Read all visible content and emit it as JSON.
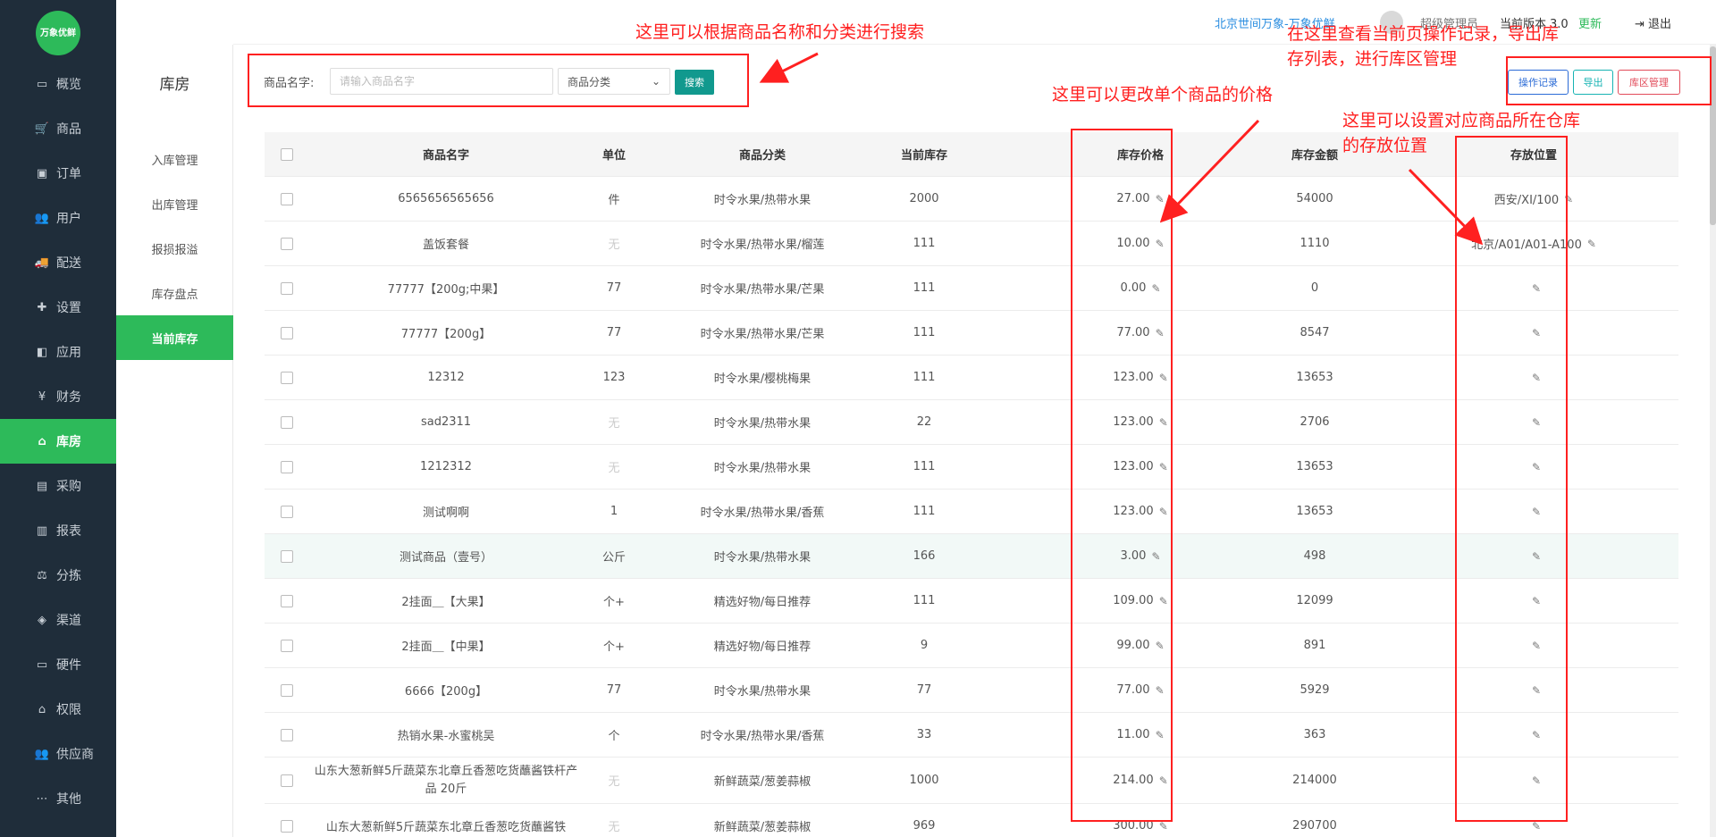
{
  "header": {
    "company_link": "北京世间万象-万象优鲜",
    "user_role": "超级管理员",
    "version_label": "当前版本",
    "version_number": "3.0",
    "update_label": "更新",
    "logout_label": "退出"
  },
  "brand": {
    "logo_text": "万象优鲜"
  },
  "sidebar": {
    "items": [
      {
        "label": "概览",
        "icon": "monitor-icon"
      },
      {
        "label": "商品",
        "icon": "cart-icon"
      },
      {
        "label": "订单",
        "icon": "order-icon"
      },
      {
        "label": "用户",
        "icon": "users-icon"
      },
      {
        "label": "配送",
        "icon": "truck-icon"
      },
      {
        "label": "设置",
        "icon": "puzzle-icon"
      },
      {
        "label": "应用",
        "icon": "app-icon"
      },
      {
        "label": "财务",
        "icon": "yen-icon"
      },
      {
        "label": "库房",
        "icon": "home-icon"
      },
      {
        "label": "采购",
        "icon": "bus-icon"
      },
      {
        "label": "报表",
        "icon": "chart-icon"
      },
      {
        "label": "分拣",
        "icon": "scale-icon"
      },
      {
        "label": "渠道",
        "icon": "box-icon"
      },
      {
        "label": "硬件",
        "icon": "desktop-icon"
      },
      {
        "label": "权限",
        "icon": "bank-icon"
      },
      {
        "label": "供应商",
        "icon": "supplier-icon"
      },
      {
        "label": "其他",
        "icon": "more-icon"
      }
    ]
  },
  "submenu": {
    "title": "库房",
    "items": [
      "入库管理",
      "出库管理",
      "报损报溢",
      "库存盘点",
      "当前库存"
    ]
  },
  "search": {
    "label": "商品名字:",
    "placeholder": "请输入商品名字",
    "category_select": "商品分类",
    "search_button": "搜索"
  },
  "actions": {
    "log_button": "操作记录",
    "export_button": "导出",
    "zone_button": "库区管理"
  },
  "table": {
    "columns": [
      "商品名字",
      "单位",
      "商品分类",
      "当前库存",
      "库存价格",
      "库存金额",
      "存放位置"
    ],
    "rows": [
      {
        "name": "6565656565656",
        "unit": "件",
        "category": "时令水果/热带水果",
        "stock": "2000",
        "price": "27.00",
        "amount": "54000",
        "location": "西安/XI/100"
      },
      {
        "name": "盖饭套餐",
        "unit": "无",
        "category": "时令水果/热带水果/榴莲",
        "stock": "111",
        "price": "10.00",
        "amount": "1110",
        "location": "北京/A01/A01-A100"
      },
      {
        "name": "77777【200g;中果】",
        "unit": "77",
        "category": "时令水果/热带水果/芒果",
        "stock": "111",
        "price": "0.00",
        "amount": "0",
        "location": ""
      },
      {
        "name": "77777【200g】",
        "unit": "77",
        "category": "时令水果/热带水果/芒果",
        "stock": "111",
        "price": "77.00",
        "amount": "8547",
        "location": ""
      },
      {
        "name": "12312",
        "unit": "123",
        "category": "时令水果/樱桃梅果",
        "stock": "111",
        "price": "123.00",
        "amount": "13653",
        "location": ""
      },
      {
        "name": "sad2311",
        "unit": "无",
        "category": "时令水果/热带水果",
        "stock": "22",
        "price": "123.00",
        "amount": "2706",
        "location": ""
      },
      {
        "name": "1212312",
        "unit": "无",
        "category": "时令水果/热带水果",
        "stock": "111",
        "price": "123.00",
        "amount": "13653",
        "location": ""
      },
      {
        "name": "测试啊啊",
        "unit": "1",
        "category": "时令水果/热带水果/香蕉",
        "stock": "111",
        "price": "123.00",
        "amount": "13653",
        "location": ""
      },
      {
        "name": "测试商品（壹号）",
        "unit": "公斤",
        "category": "时令水果/热带水果",
        "stock": "166",
        "price": "3.00",
        "amount": "498",
        "location": ""
      },
      {
        "name": "2挂面＿【大果】",
        "unit": "个+",
        "category": "精选好物/每日推荐",
        "stock": "111",
        "price": "109.00",
        "amount": "12099",
        "location": ""
      },
      {
        "name": "2挂面＿【中果】",
        "unit": "个+",
        "category": "精选好物/每日推荐",
        "stock": "9",
        "price": "99.00",
        "amount": "891",
        "location": ""
      },
      {
        "name": "6666【200g】",
        "unit": "77",
        "category": "时令水果/热带水果",
        "stock": "77",
        "price": "77.00",
        "amount": "5929",
        "location": ""
      },
      {
        "name": "热销水果-水蜜桃吴",
        "unit": "个",
        "category": "时令水果/热带水果/香蕉",
        "stock": "33",
        "price": "11.00",
        "amount": "363",
        "location": ""
      },
      {
        "name": "山东大葱新鲜5斤蔬菜东北章丘香葱吃货蘸酱铁杆产品 20斤",
        "unit": "无",
        "category": "新鲜蔬菜/葱姜蒜椒",
        "stock": "1000",
        "price": "214.00",
        "amount": "214000",
        "location": ""
      },
      {
        "name": "山东大葱新鲜5斤蔬菜东北章丘香葱吃货蘸酱铁",
        "unit": "无",
        "category": "新鲜蔬菜/葱姜蒜椒",
        "stock": "969",
        "price": "300.00",
        "amount": "290700",
        "location": ""
      }
    ]
  },
  "annotations": {
    "search_note": "这里可以根据商品名称和分类进行搜索",
    "price_note": "这里可以更改单个商品的价格",
    "location_note_line1": "这里可以设置对应商品所在仓库",
    "location_note_line2": "的存放位置",
    "export_note_line1": "在这里查看当前页操作记录，导出库",
    "export_note_line2": "存列表，进行库区管理"
  },
  "colors": {
    "sidebar_bg": "#1f2d3a",
    "accent": "#2dba5a",
    "annotation": "#ff2020",
    "search_button": "#11998e"
  }
}
